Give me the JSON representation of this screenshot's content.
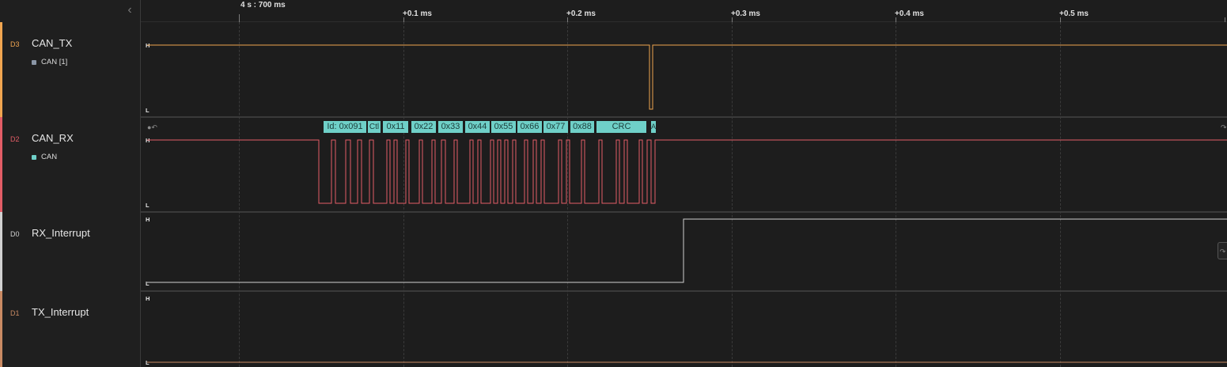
{
  "sidebar": {
    "collapse_icon": "chevron-left-icon",
    "collapse_glyph": "‹",
    "channels": [
      {
        "id": "D3",
        "name": "CAN_TX",
        "color": "#f0a550",
        "analyzer": "CAN [1]",
        "analyzer_color": "#8a96a6"
      },
      {
        "id": "D2",
        "name": "CAN_RX",
        "color": "#e25d66",
        "analyzer": "CAN",
        "analyzer_color": "#6fd0c8"
      },
      {
        "id": "D0",
        "name": "RX_Interrupt",
        "color": "#d0d0d0"
      },
      {
        "id": "D1",
        "name": "TX_Interrupt",
        "color": "#c98a63"
      }
    ]
  },
  "ruler": {
    "origin_label": "4 s : 700 ms",
    "ticks": [
      "+0.1 ms",
      "+0.2 ms",
      "+0.3 ms",
      "+0.4 ms",
      "+0.5 ms"
    ]
  },
  "levels": {
    "high": "H",
    "low": "L"
  },
  "decoded_frames": [
    "Id: 0x091",
    "Ctl",
    "0x11",
    "0x22",
    "0x33",
    "0x44",
    "0x55",
    "0x66",
    "0x77",
    "0x88",
    "CRC",
    "A"
  ],
  "colors": {
    "background": "#1d1d1d",
    "can_tx": "#f0a550",
    "can_rx": "#e25d66",
    "rx_interrupt": "#d0d0d0",
    "tx_interrupt": "#c98a63",
    "decoder": "#6fd0c8"
  }
}
